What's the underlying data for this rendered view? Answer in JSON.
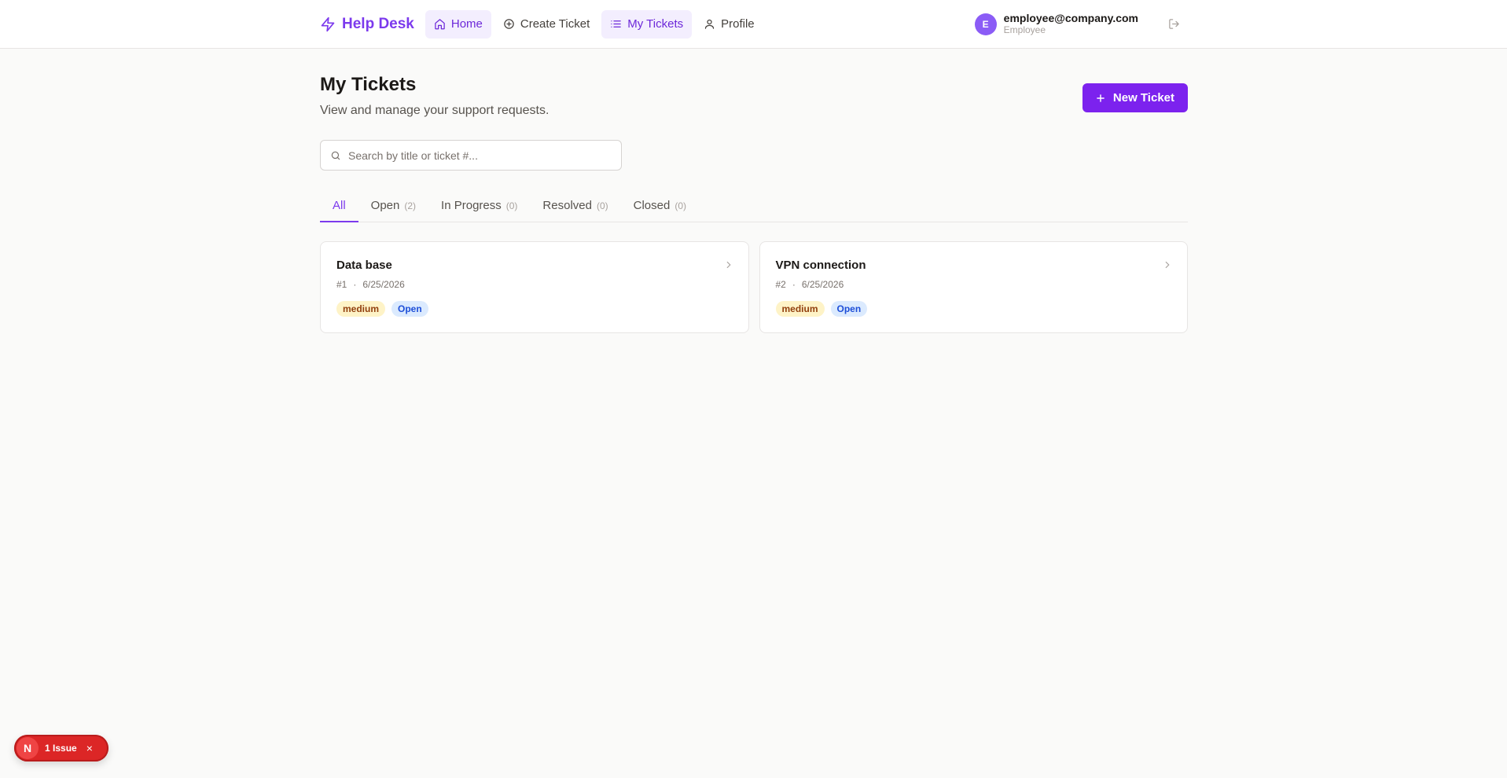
{
  "header": {
    "brand": "Help Desk",
    "nav": [
      {
        "label": "Home",
        "icon": "home-icon"
      },
      {
        "label": "Create Ticket",
        "icon": "plus-circle-icon"
      },
      {
        "label": "My Tickets",
        "icon": "list-icon"
      },
      {
        "label": "Profile",
        "icon": "user-icon"
      }
    ],
    "user": {
      "initial": "E",
      "email": "employee@company.com",
      "role": "Employee"
    },
    "accent": "#7c3aed"
  },
  "main": {
    "title": "My Tickets",
    "subtitle": "View and manage your support requests.",
    "new_ticket_label": "New Ticket",
    "search_placeholder": "Search by title or ticket #...",
    "tabs": [
      {
        "label": "All",
        "count": ""
      },
      {
        "label": "Open",
        "count": "(2)"
      },
      {
        "label": "In Progress",
        "count": "(0)"
      },
      {
        "label": "Resolved",
        "count": "(0)"
      },
      {
        "label": "Closed",
        "count": "(0)"
      }
    ],
    "tickets": [
      {
        "title": "Data base",
        "number": "#1",
        "separator": "·",
        "date": "6/25/2026",
        "priority": "medium",
        "status": "Open"
      },
      {
        "title": "VPN connection",
        "number": "#2",
        "separator": "·",
        "date": "6/25/2026",
        "priority": "medium",
        "status": "Open"
      }
    ]
  },
  "dev_overlay": {
    "logo": "N",
    "label": "1 Issue",
    "close": "×",
    "color": "#dc2626"
  }
}
